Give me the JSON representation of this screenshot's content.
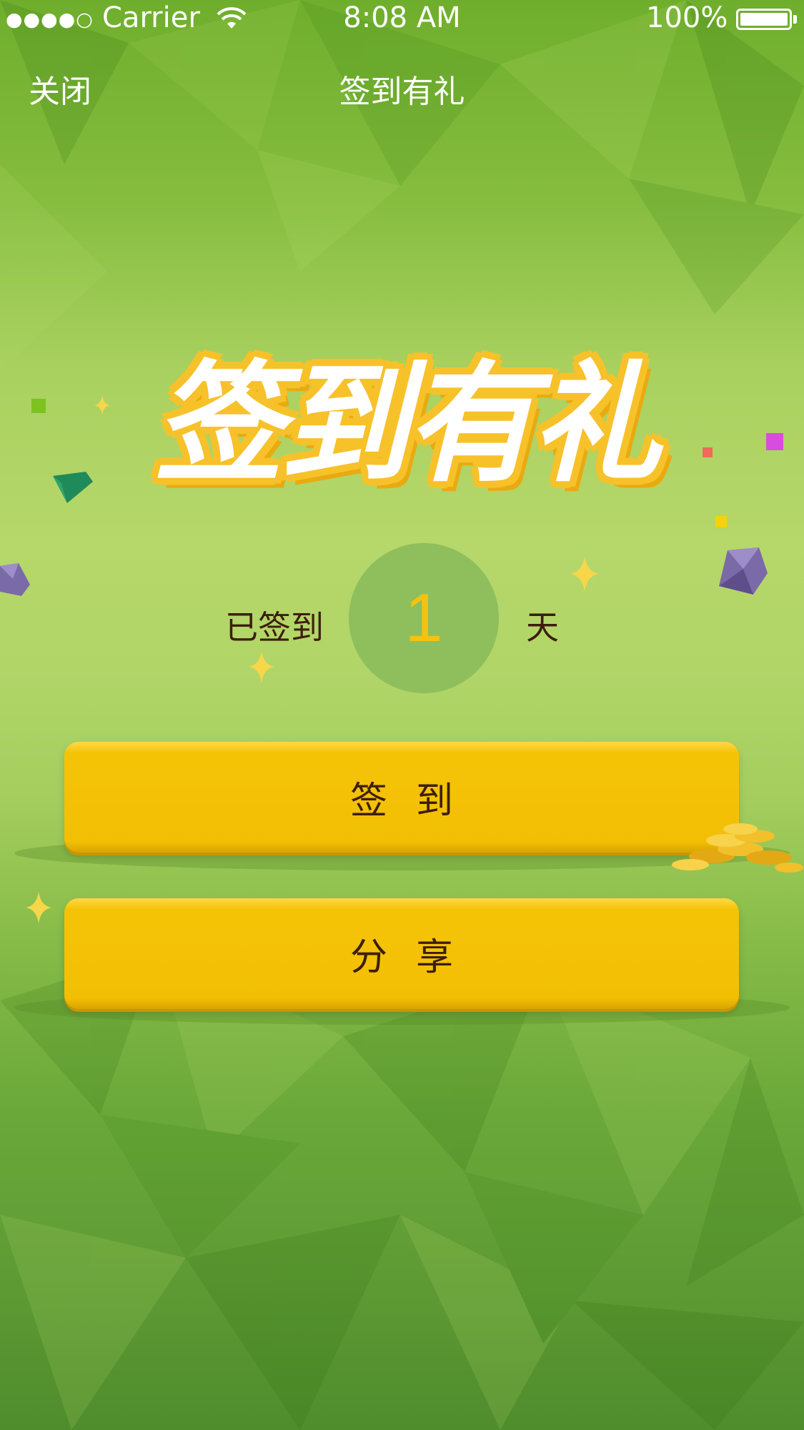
{
  "status_bar": {
    "signal": "●●●●○",
    "carrier": "Carrier",
    "time": "8:08 AM",
    "battery": "100%"
  },
  "nav": {
    "close_label": "关闭",
    "title": "签到有礼"
  },
  "banner": {
    "text": "签到有礼"
  },
  "checkin": {
    "prefix": "已签到",
    "days": "1",
    "suffix": "天"
  },
  "buttons": {
    "checkin_label": "签到",
    "share_label": "分享"
  },
  "colors": {
    "accent": "#f2bf05",
    "banner_outline": "#f7c12a",
    "text_dark": "#3d1e0c",
    "day_number": "#f5c210"
  }
}
